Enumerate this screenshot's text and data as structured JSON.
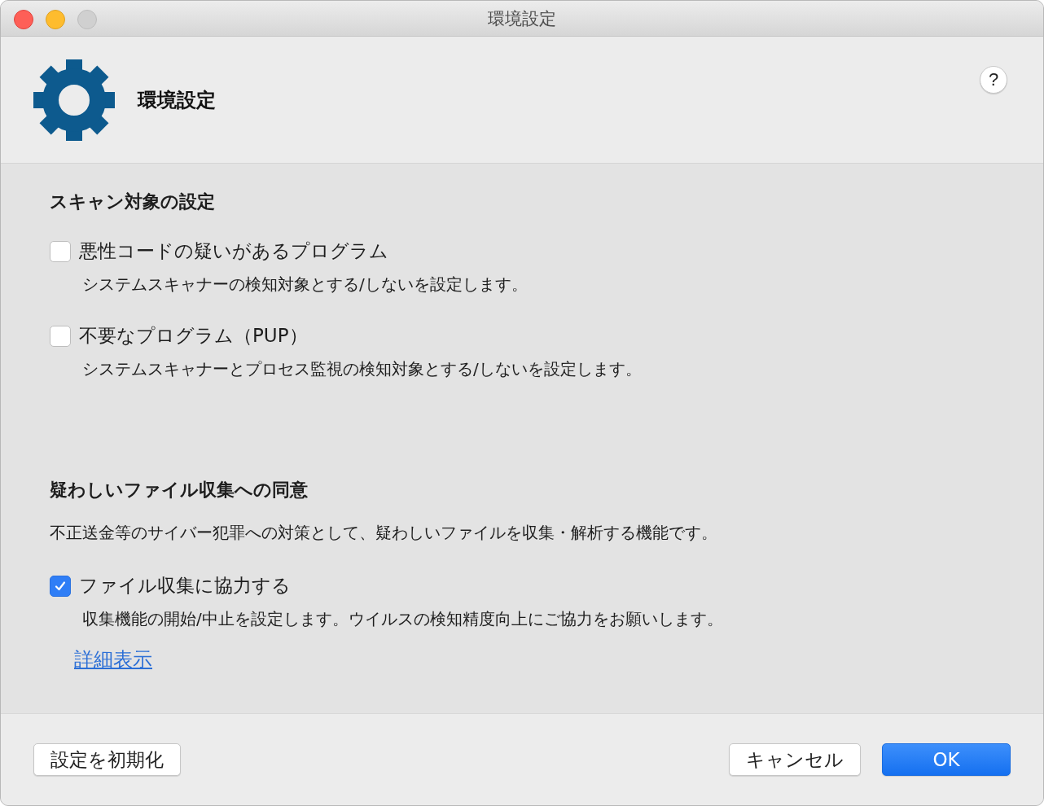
{
  "window": {
    "title": "環境設定"
  },
  "header": {
    "title": "環境設定",
    "help": "?"
  },
  "sections": [
    {
      "title": "スキャン対象の設定",
      "options": [
        {
          "label": "悪性コードの疑いがあるプログラム",
          "description": "システムスキャナーの検知対象とする/しないを設定します。",
          "checked": false
        },
        {
          "label": "不要なプログラム（PUP）",
          "description": "システムスキャナーとプロセス監視の検知対象とする/しないを設定します。",
          "checked": false
        }
      ]
    },
    {
      "title": "疑わしいファイル収集への同意",
      "description": "不正送金等のサイバー犯罪への対策として、疑わしいファイルを収集・解析する機能です。",
      "options": [
        {
          "label": "ファイル収集に協力する",
          "description": "収集機能の開始/中止を設定します。ウイルスの検知精度向上にご協力をお願いします。",
          "checked": true
        }
      ],
      "link": "詳細表示"
    }
  ],
  "buttons": [
    {
      "label": "設定を初期化",
      "kind": "default"
    },
    {
      "label": "キャンセル",
      "kind": "default"
    },
    {
      "label": "OK",
      "kind": "primary"
    }
  ]
}
